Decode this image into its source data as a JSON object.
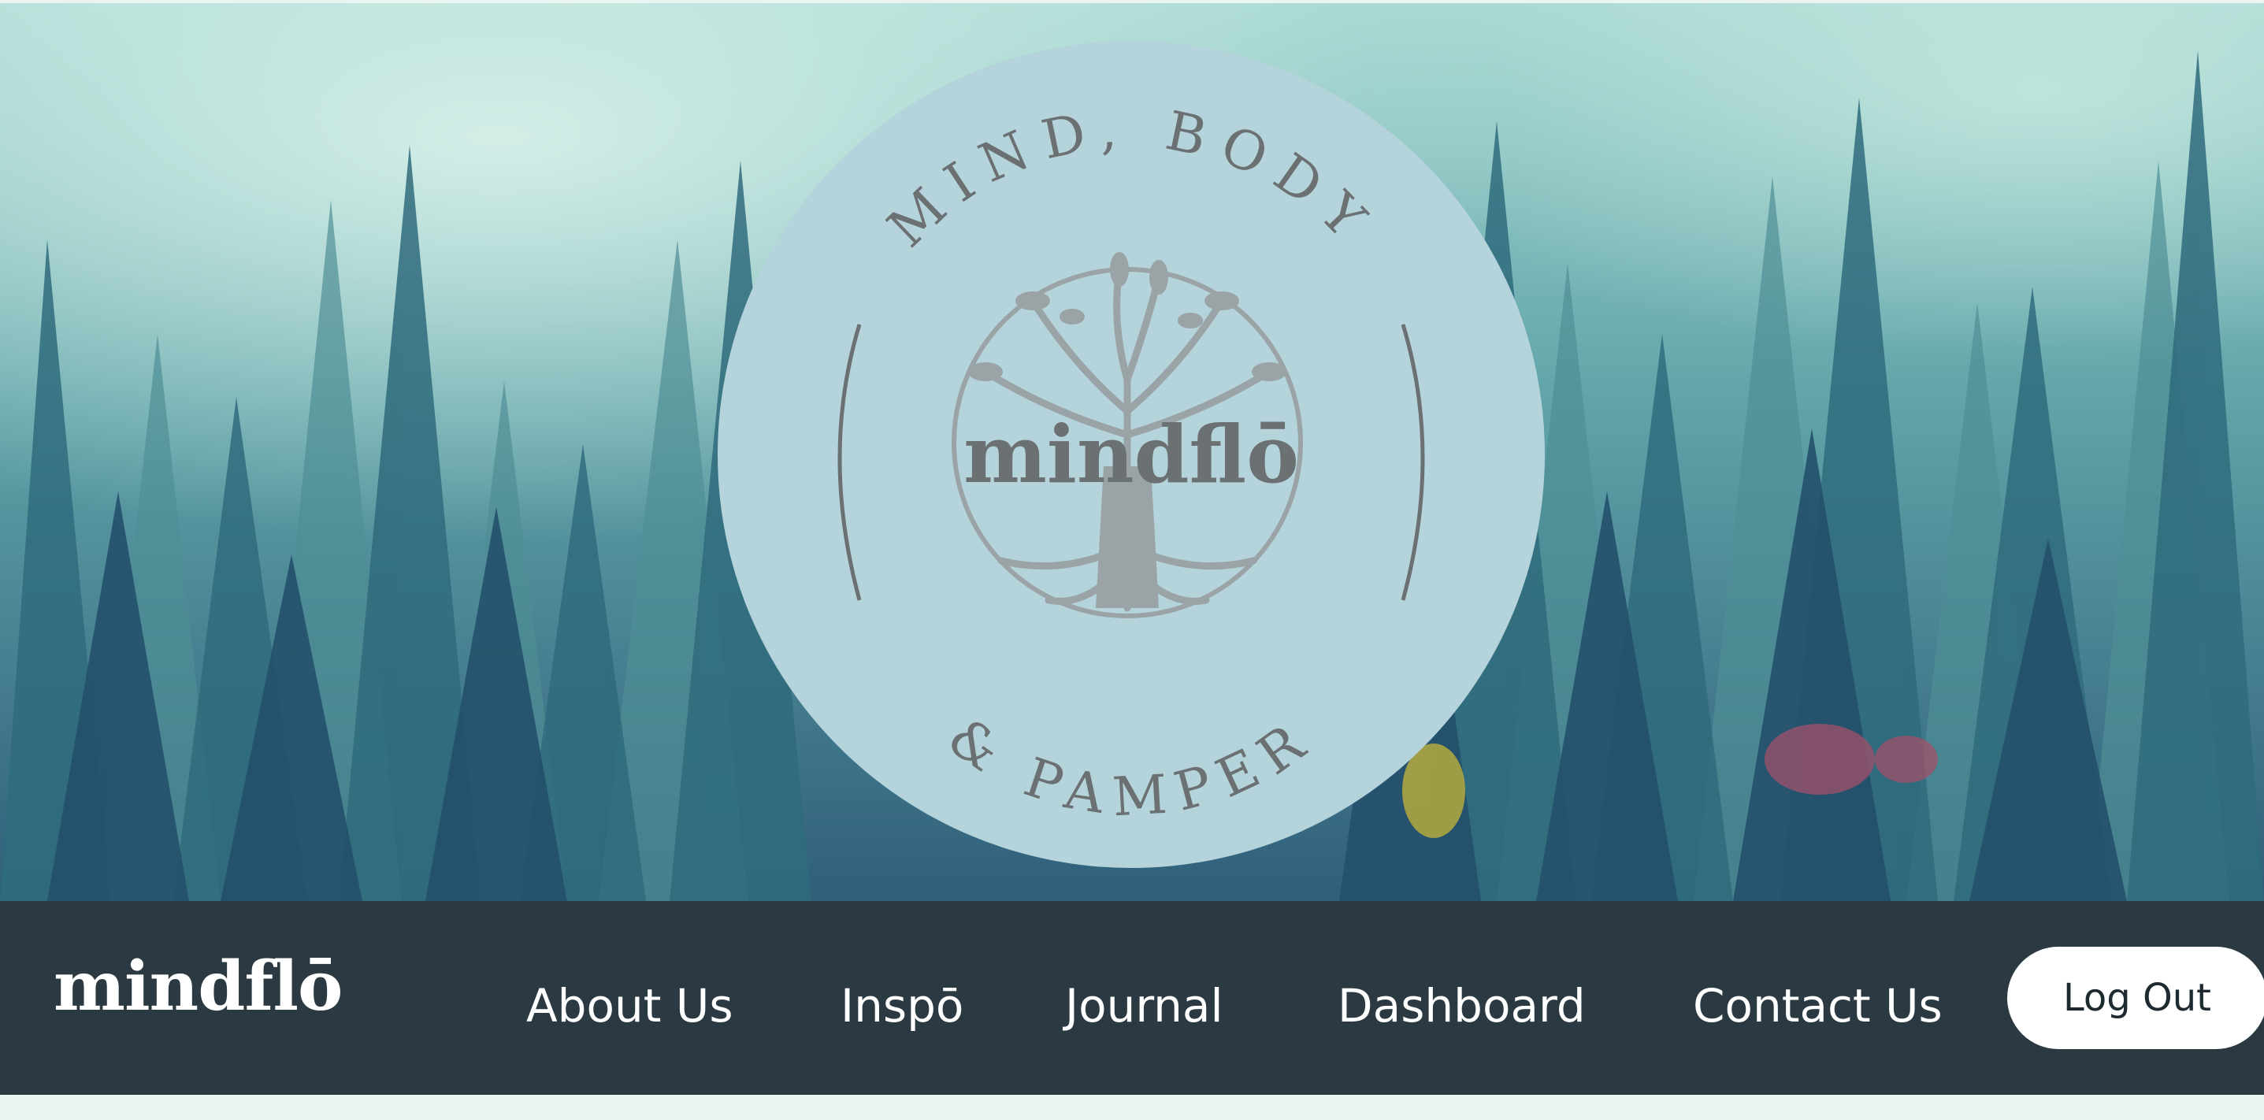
{
  "hero": {
    "badge": {
      "top_text": "MIND, BODY",
      "bottom_text": "& PAMPER",
      "center_text": "mindflō",
      "tree_icon": "tree-of-life-icon"
    },
    "colors": {
      "badge_fill": "#b4d3da",
      "badge_text": "#6b7072",
      "tree": "#9aa3a5"
    }
  },
  "navbar": {
    "brand": "mindflō",
    "links": [
      "About Us",
      "Inspō",
      "Journal",
      "Dashboard",
      "Contact Us"
    ],
    "logout_label": "Log Out",
    "colors": {
      "background": "#2b3a42",
      "text": "#ffffff"
    }
  }
}
